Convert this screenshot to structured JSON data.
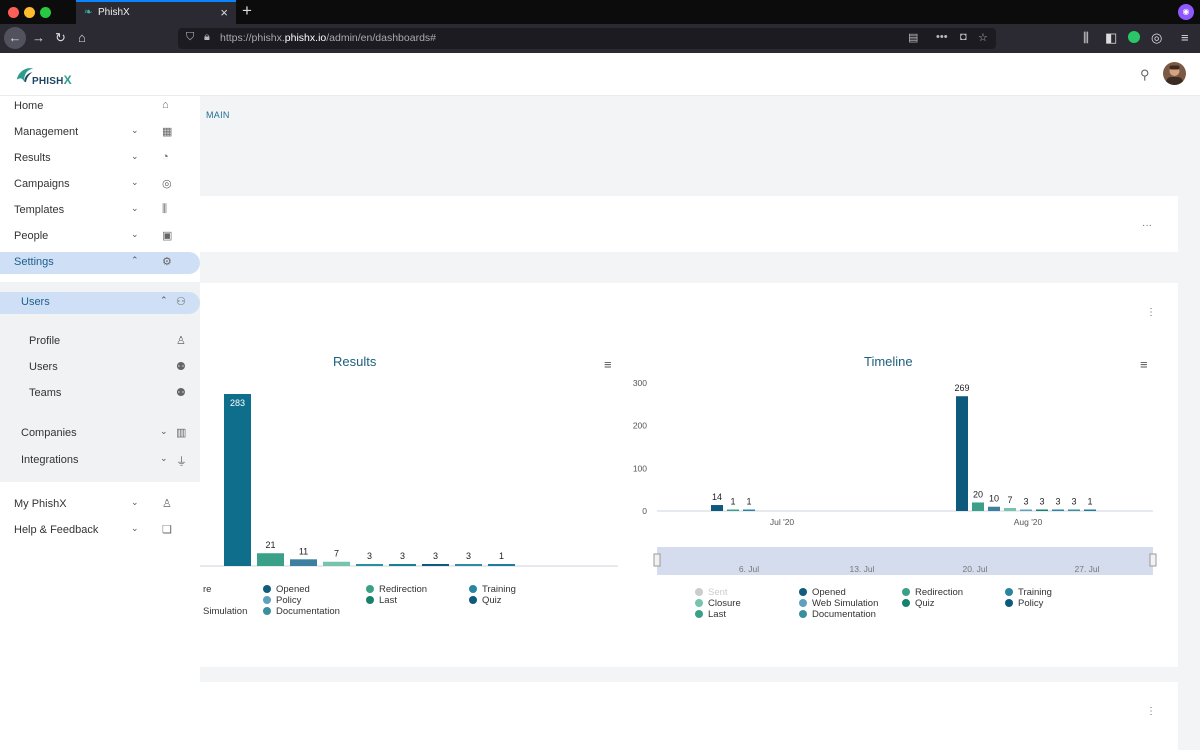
{
  "browser": {
    "tab_title": "PhishX",
    "url_prefix": "https://phishx.",
    "url_domain": "phishx.io",
    "url_path": "/admin/en/dashboards#"
  },
  "app": {
    "logo_text": "PHISH",
    "logo_x": "X"
  },
  "breadcrumb": "MAIN",
  "sidebar": {
    "items": [
      {
        "label": "Home",
        "icon": "home-icon"
      },
      {
        "label": "Management",
        "icon": "grid-icon"
      },
      {
        "label": "Results",
        "icon": "pie-icon"
      },
      {
        "label": "Campaigns",
        "icon": "target-icon"
      },
      {
        "label": "Templates",
        "icon": "books-icon"
      },
      {
        "label": "People",
        "icon": "contact-icon"
      },
      {
        "label": "Settings",
        "icon": "gears-icon"
      },
      {
        "label": "Users",
        "icon": "user-gear-icon"
      },
      {
        "label": "Profile",
        "icon": "person-icon"
      },
      {
        "label": "Users",
        "icon": "users-icon"
      },
      {
        "label": "Teams",
        "icon": "team-icon"
      },
      {
        "label": "Companies",
        "icon": "buildings-icon"
      },
      {
        "label": "Integrations",
        "icon": "plug-icon"
      },
      {
        "label": "My PhishX",
        "icon": "badge-icon"
      },
      {
        "label": "Help & Feedback",
        "icon": "chat-icon"
      }
    ]
  },
  "chart_data": [
    {
      "type": "bar",
      "title": "Results",
      "values": [
        283,
        21,
        11,
        7,
        3,
        3,
        3,
        3,
        1
      ],
      "colors": [
        "#0f6e8c",
        "#3aa188",
        "#3c7fa0",
        "#74c4ae",
        "#2a8fa3",
        "#1a7f93",
        "#0e5a7d",
        "#2d8ca5",
        "#1c7d9c"
      ],
      "legend": [
        {
          "label": "re",
          "color": "#ffffff"
        },
        {
          "label": "Opened",
          "color": "#125c7d"
        },
        {
          "label": "Redirection",
          "color": "#3aa188"
        },
        {
          "label": "Training",
          "color": "#2a86a0"
        },
        {
          "label": "Simulation",
          "color": "#ffffff"
        },
        {
          "label": "Policy",
          "color": "#5fa0be"
        },
        {
          "label": "Last",
          "color": "#16826b"
        },
        {
          "label": "Quiz",
          "color": "#0e5a7d"
        },
        {
          "label": "Documentation",
          "color": "#3a8f9e"
        }
      ]
    },
    {
      "type": "bar",
      "title": "Timeline",
      "yticks": [
        "300",
        "200",
        "100",
        "0"
      ],
      "ylim": [
        0,
        300
      ],
      "xticks": [
        "Jul '20",
        "Aug '20"
      ],
      "groups": [
        {
          "label": "Jul '20",
          "values": [
            14,
            1,
            1
          ]
        },
        {
          "label": "Aug '20",
          "values": [
            269,
            20,
            10,
            7,
            3,
            3,
            3,
            3,
            1
          ]
        }
      ],
      "navigator_ticks": [
        "6. Jul",
        "13. Jul",
        "20. Jul",
        "27. Jul"
      ],
      "legend": [
        {
          "label": "Sent",
          "color": "#cccccc"
        },
        {
          "label": "Opened",
          "color": "#125c7d"
        },
        {
          "label": "Redirection",
          "color": "#3aa188"
        },
        {
          "label": "Training",
          "color": "#2a86a0"
        },
        {
          "label": "Closure",
          "color": "#74c4ae"
        },
        {
          "label": "Web Simulation",
          "color": "#5fa0be"
        },
        {
          "label": "Quiz",
          "color": "#16826b"
        },
        {
          "label": "Policy",
          "color": "#0e5a7d"
        },
        {
          "label": "Last",
          "color": "#3aa188"
        },
        {
          "label": "Documentation",
          "color": "#3a8f9e"
        }
      ]
    }
  ]
}
